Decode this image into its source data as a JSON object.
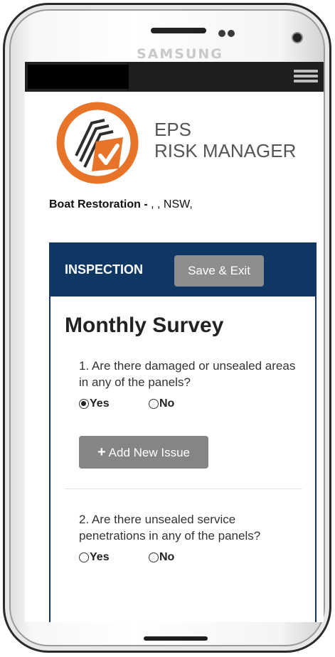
{
  "device": {
    "brand": "SAMSUNG"
  },
  "app": {
    "title_line1": "EPS",
    "title_line2": "RISK MANAGER",
    "logo_icon": "eps-logo-icon",
    "menu_icon": "hamburger-menu-icon",
    "colors": {
      "accent": "#e8742a",
      "navy": "#0e3763",
      "button_gray": "#8d8d8d"
    }
  },
  "location": {
    "name": "Boat Restoration -",
    "details": " , , NSW,"
  },
  "inspection": {
    "header": "INSPECTION",
    "save_exit_label": "Save & Exit",
    "survey_title": "Monthly Survey",
    "questions": [
      {
        "text": "1. Are there damaged or unsealed areas in any of the panels?",
        "yes_label": "Yes",
        "no_label": "No",
        "selected": "Yes"
      },
      {
        "text": "2. Are there unsealed service penetrations in any of the panels?",
        "yes_label": "Yes",
        "no_label": "No",
        "selected": ""
      }
    ],
    "add_issue_label": "Add New Issue"
  }
}
